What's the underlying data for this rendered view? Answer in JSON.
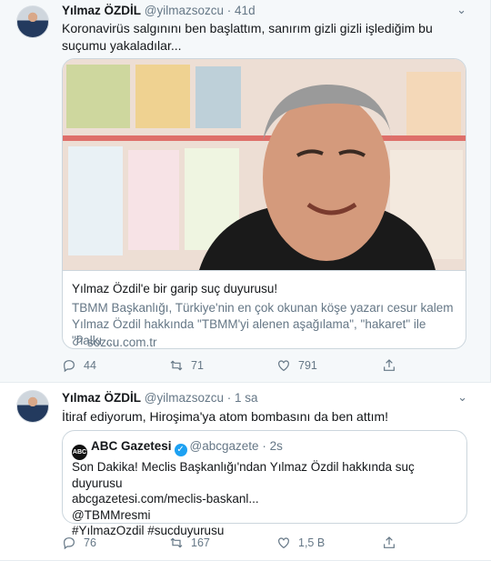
{
  "tweets": [
    {
      "name": "Yılmaz ÖZDİL",
      "handle": "@yilmazsozcu",
      "time": "41d",
      "text": "Koronavirüs salgınını ben başlattım, sanırım gizli gizli işlediğim bu suçumu yakaladılar...",
      "card": {
        "title": "Yılmaz Özdil'e bir garip suç duyurusu!",
        "desc": "TBMM Başkanlığı, Türkiye'nin en çok okunan köşe yazarı cesur kalem Yılmaz Özdil hakkında \"TBMM'yi alenen aşağılama\", \"hakaret\" ile \"halkı ...",
        "link": "sozcu.com.tr"
      },
      "stats": {
        "replies": "44",
        "retweets": "71",
        "likes": "791"
      }
    },
    {
      "name": "Yılmaz ÖZDİL",
      "handle": "@yilmazsozcu",
      "time": "1 sa",
      "text": "İtiraf ediyorum, Hiroşima'ya atom bombasını da ben attım!",
      "quote": {
        "logo_text": "ABC",
        "name": "ABC Gazetesi",
        "handle": "@abcgazete",
        "time": "2s",
        "lines": [
          "Son Dakika! Meclis Başkanlığı'ndan Yılmaz Özdil hakkında suç duyurusu",
          "abcgazetesi.com/meclis-baskanl...",
          "@TBMMresmi",
          "#YılmazOzdil #sucduyurusu"
        ]
      },
      "stats": {
        "replies": "76",
        "retweets": "167",
        "likes": "1,5 B"
      }
    }
  ],
  "icons": {
    "reply": "reply-icon",
    "retweet": "retweet-icon",
    "like": "heart-icon",
    "share": "share-icon",
    "more": "chevron-down-icon",
    "link": "link-icon",
    "verified": "verified-badge-icon"
  },
  "colors": {
    "accent": "#1da1f2",
    "text": "#14171a",
    "muted": "#657786",
    "border": "#ccd6dd",
    "highlight_bg": "#f5f8fa"
  }
}
